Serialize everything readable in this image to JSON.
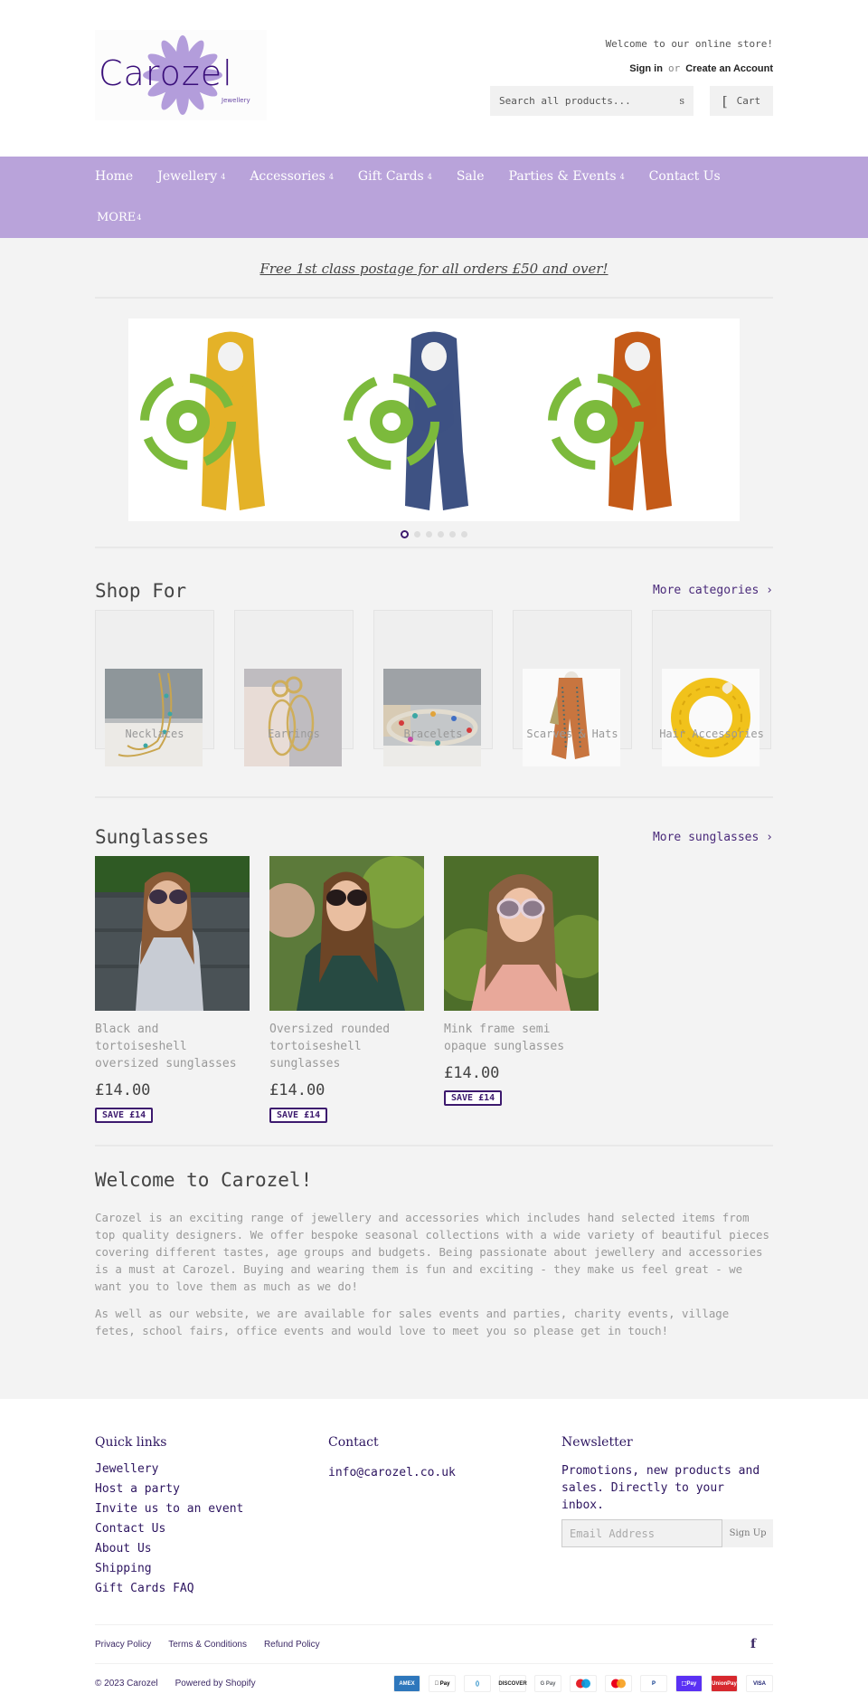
{
  "header": {
    "logo_text": "Carozel",
    "logo_subtext": "Jewellery",
    "welcome": "Welcome to our online store!",
    "sign_in": "Sign in",
    "or": "or",
    "create_account": "Create an Account",
    "search_placeholder": "Search all products...",
    "search_icon_glyph": "s",
    "cart_icon_glyph": "[",
    "cart_label": "Cart"
  },
  "nav": {
    "items": [
      {
        "label": "Home",
        "dropdown": false
      },
      {
        "label": "Jewellery",
        "dropdown": true
      },
      {
        "label": "Accessories",
        "dropdown": true
      },
      {
        "label": "Gift Cards",
        "dropdown": true
      },
      {
        "label": "Sale",
        "dropdown": false
      },
      {
        "label": "Parties & Events",
        "dropdown": true
      },
      {
        "label": "Contact Us",
        "dropdown": false
      }
    ],
    "more_label": "MORE",
    "caret_glyph": "4"
  },
  "promo": {
    "text": "Free 1st class postage for all orders £50 and over!"
  },
  "slider": {
    "slides": [
      {
        "name": "Mustard scarf",
        "color": "#e4b228"
      },
      {
        "name": "Navy scarf",
        "color": "#3e5283"
      },
      {
        "name": "Rust scarf",
        "color": "#c45a18"
      }
    ],
    "dot_count": 6,
    "active_dot": 1
  },
  "shop_for": {
    "title": "Shop For",
    "more_link": "More categories ›",
    "categories": [
      {
        "label": "Necklaces"
      },
      {
        "label": "Earrings"
      },
      {
        "label": "Bracelets"
      },
      {
        "label": "Scarves & Hats"
      },
      {
        "label": "Hair Accessories"
      }
    ]
  },
  "sunglasses": {
    "title": "Sunglasses",
    "more_link": "More sunglasses ›",
    "products": [
      {
        "name": "Black and tortoiseshell oversized sunglasses",
        "price": "£14.00",
        "badge": "SAVE £14"
      },
      {
        "name": "Oversized rounded tortoiseshell sunglasses",
        "price": "£14.00",
        "badge": "SAVE £14"
      },
      {
        "name": "Mink frame semi opaque sunglasses",
        "price": "£14.00",
        "badge": "SAVE £14"
      }
    ]
  },
  "welcome_section": {
    "title": "Welcome to Carozel!",
    "paragraphs": [
      "Carozel is an exciting range of jewellery and accessories which includes hand selected items from top quality designers. We offer bespoke seasonal collections with a wide variety of beautiful pieces covering different tastes, age groups and budgets. Being passionate about jewellery and accessories is a must at Carozel. Buying and wearing them is fun and exciting - they make us feel great - we want you to love them as much as we do!",
      "As well as our website, we are available for sales events and parties, charity events, village fetes, school fairs, office events and would love to meet you so please get in touch!"
    ]
  },
  "footer": {
    "quick_links": {
      "title": "Quick links",
      "items": [
        "Jewellery",
        "Host a party",
        "Invite us to an event",
        "Contact Us",
        "About Us",
        "Shipping",
        "Gift Cards FAQ"
      ]
    },
    "contact": {
      "title": "Contact",
      "email": "info@carozel.co.uk"
    },
    "newsletter": {
      "title": "Newsletter",
      "text": "Promotions, new products and sales. Directly to your inbox.",
      "email_placeholder": "Email Address",
      "button": "Sign Up"
    },
    "policy_links": [
      "Privacy Policy",
      "Terms & Conditions",
      "Refund Policy"
    ],
    "facebook_glyph": "f",
    "copyright": "© 2023 Carozel",
    "powered_by": "Powered by Shopify",
    "payment_methods": [
      {
        "name": "American Express",
        "label": "AMEX",
        "bg": "#2e77bc",
        "fg": "#ffffff"
      },
      {
        "name": "Apple Pay",
        "label": " Pay",
        "bg": "#ffffff",
        "fg": "#000000"
      },
      {
        "name": "Diners Club",
        "label": "()",
        "bg": "#ffffff",
        "fg": "#0079be"
      },
      {
        "name": "Discover",
        "label": "DISCOVER",
        "bg": "#ffffff",
        "fg": "#222222"
      },
      {
        "name": "Google Pay",
        "label": "G Pay",
        "bg": "#ffffff",
        "fg": "#5f6368"
      },
      {
        "name": "Maestro",
        "label": "",
        "bg": "#ffffff",
        "fg": "#000000"
      },
      {
        "name": "Mastercard",
        "label": "",
        "bg": "#ffffff",
        "fg": "#000000"
      },
      {
        "name": "PayPal",
        "label": "P",
        "bg": "#ffffff",
        "fg": "#003087"
      },
      {
        "name": "Shop Pay",
        "label": "⬚Pay",
        "bg": "#5a31f4",
        "fg": "#ffffff"
      },
      {
        "name": "UnionPay",
        "label": "UnionPay",
        "bg": "#d7282e",
        "fg": "#ffffff"
      },
      {
        "name": "Visa",
        "label": "VISA",
        "bg": "#ffffff",
        "fg": "#1a1f71"
      }
    ]
  }
}
